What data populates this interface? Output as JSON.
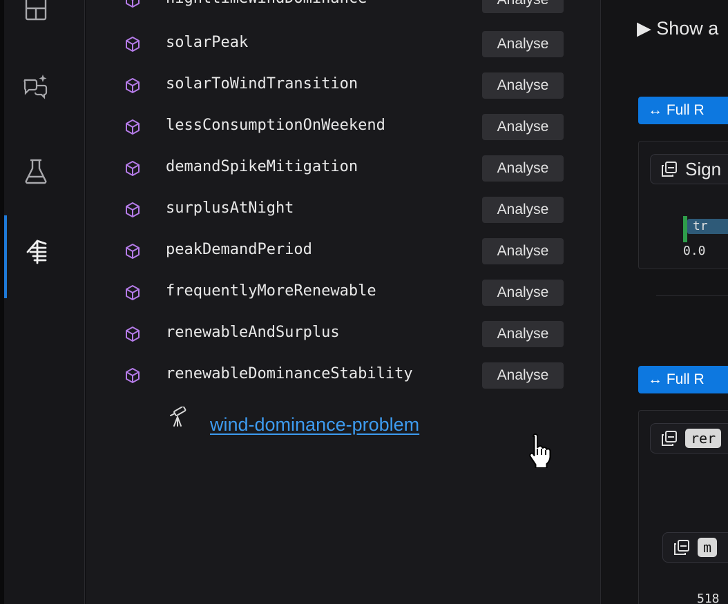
{
  "activity_bar": {
    "items": [
      {
        "icon": "layout-panels-icon"
      },
      {
        "icon": "chat-sparkle-icon"
      },
      {
        "icon": "flask-icon"
      },
      {
        "icon": "signal-tower-icon",
        "active": true
      }
    ]
  },
  "sidebar": {
    "partial_top_item": {
      "name": "nighttimeWindDominance",
      "button": "Analyse"
    },
    "items": [
      {
        "name": "solarPeak",
        "button": "Analyse"
      },
      {
        "name": "solarToWindTransition",
        "button": "Analyse"
      },
      {
        "name": "lessConsumptionOnWeekend",
        "button": "Analyse"
      },
      {
        "name": "demandSpikeMitigation",
        "button": "Analyse"
      },
      {
        "name": "surplusAtNight",
        "button": "Analyse"
      },
      {
        "name": "peakDemandPeriod",
        "button": "Analyse"
      },
      {
        "name": "frequentlyMoreRenewable",
        "button": "Analyse"
      },
      {
        "name": "renewableAndSurplus",
        "button": "Analyse"
      },
      {
        "name": "renewableDominanceStability",
        "button": "Analyse"
      }
    ],
    "problem_link": "wind-dominance-problem"
  },
  "main": {
    "show_all": "▶ Show a",
    "full_button_1": "↔ Full R",
    "card1_title": "Sign",
    "card1_chip": "tr",
    "card1_value": "0.0",
    "full_button_2": "↔ Full R",
    "card2_chip": "rer",
    "card3_chip": "m",
    "card3_value": "518"
  },
  "colors": {
    "accent": "#0d78e0",
    "link": "#3d9bf0",
    "cube": "#b57be8",
    "indicator": "#1f7ad8"
  }
}
